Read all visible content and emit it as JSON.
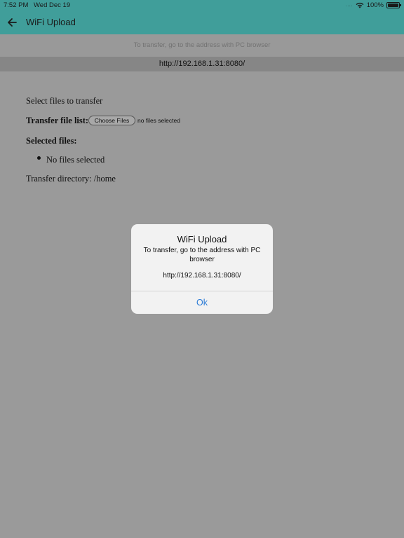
{
  "status_bar": {
    "time": "7:52 PM",
    "date": "Wed Dec 19",
    "signal_dots": "....",
    "battery": "100%",
    "battery_level": 1.0
  },
  "app_bar": {
    "title": "WiFi Upload",
    "back_icon": "arrow-left-icon",
    "color": "#409e9a"
  },
  "hint": "To transfer, go to the address with PC browser",
  "address": "http://192.168.1.31:8080/",
  "page": {
    "select_prompt": "Select files to transfer",
    "transfer_list_label": "Transfer file list:",
    "choose_button": "Choose Files",
    "no_files_selected": "no files selected",
    "selected_files_label": "Selected files:",
    "selected_files": [
      "No files selected"
    ],
    "transfer_directory": "Transfer directory: /home"
  },
  "dialog": {
    "title": "WiFi Upload",
    "message": "To transfer, go to the address with PC browser",
    "url": "http://192.168.1.31:8080/",
    "ok_label": "Ok",
    "ok_color": "#2b7bd6"
  }
}
